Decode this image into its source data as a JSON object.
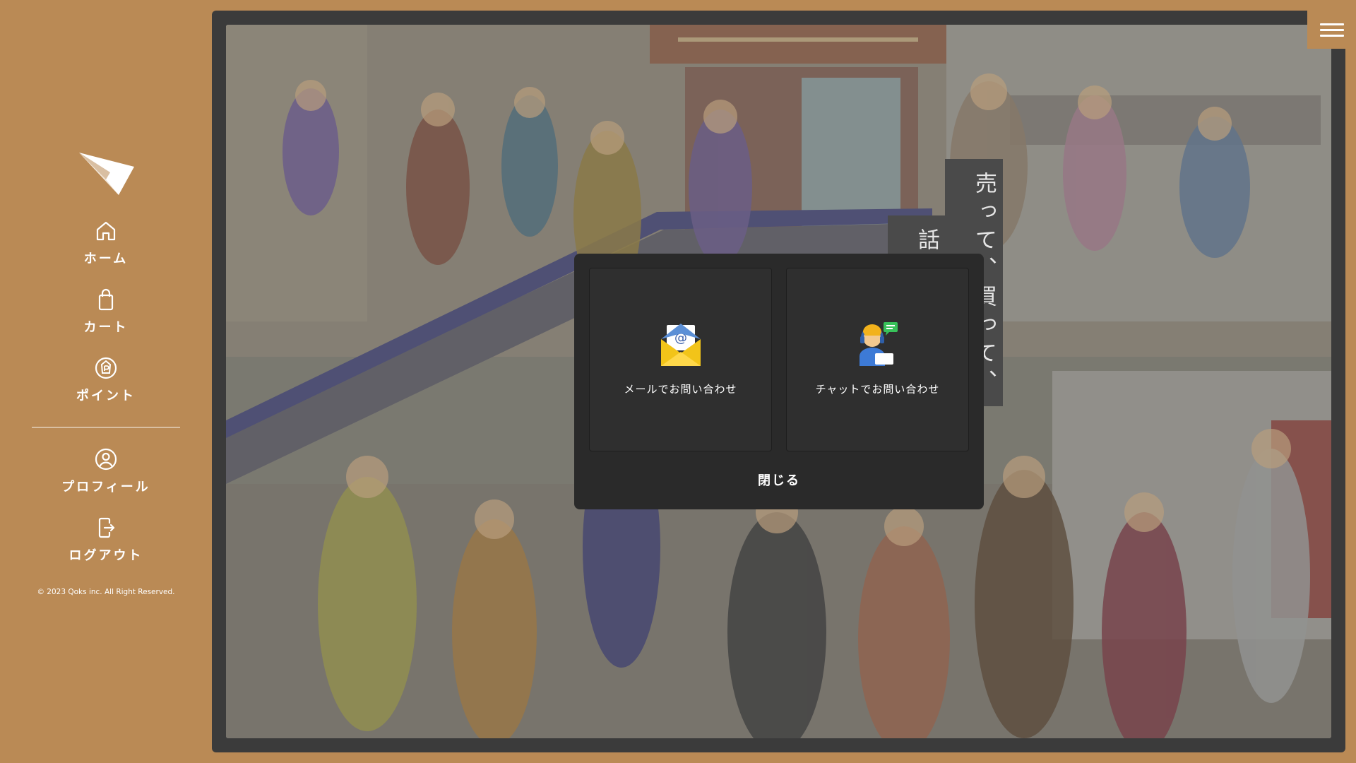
{
  "sidebar": {
    "logo_icon": "paper-plane-icon",
    "items": [
      {
        "label": "ホーム",
        "icon": "home-icon"
      },
      {
        "label": "カート",
        "icon": "shopping-bag-icon"
      },
      {
        "label": "ポイント",
        "icon": "point-badge-icon"
      },
      {
        "label": "プロフィール",
        "icon": "user-circle-icon"
      },
      {
        "label": "ログアウト",
        "icon": "logout-icon"
      }
    ],
    "copyright": "© 2023 Qoks inc. All Right Reserved."
  },
  "main": {
    "catch_copy": [
      "売って、買って、",
      "話して、楽しむ。"
    ],
    "menu_icon": "hamburger-menu-icon"
  },
  "modal": {
    "options": [
      {
        "label": "メールでお問い合わせ",
        "icon": "email-envelope-icon"
      },
      {
        "label": "チャットでお問い合わせ",
        "icon": "chat-operator-icon"
      }
    ],
    "close_label": "閉じる"
  },
  "colors": {
    "background": "#ba8a55",
    "frame": "#3b3b3b",
    "modal": "#2a2a2a",
    "text_light": "#ffffff"
  }
}
